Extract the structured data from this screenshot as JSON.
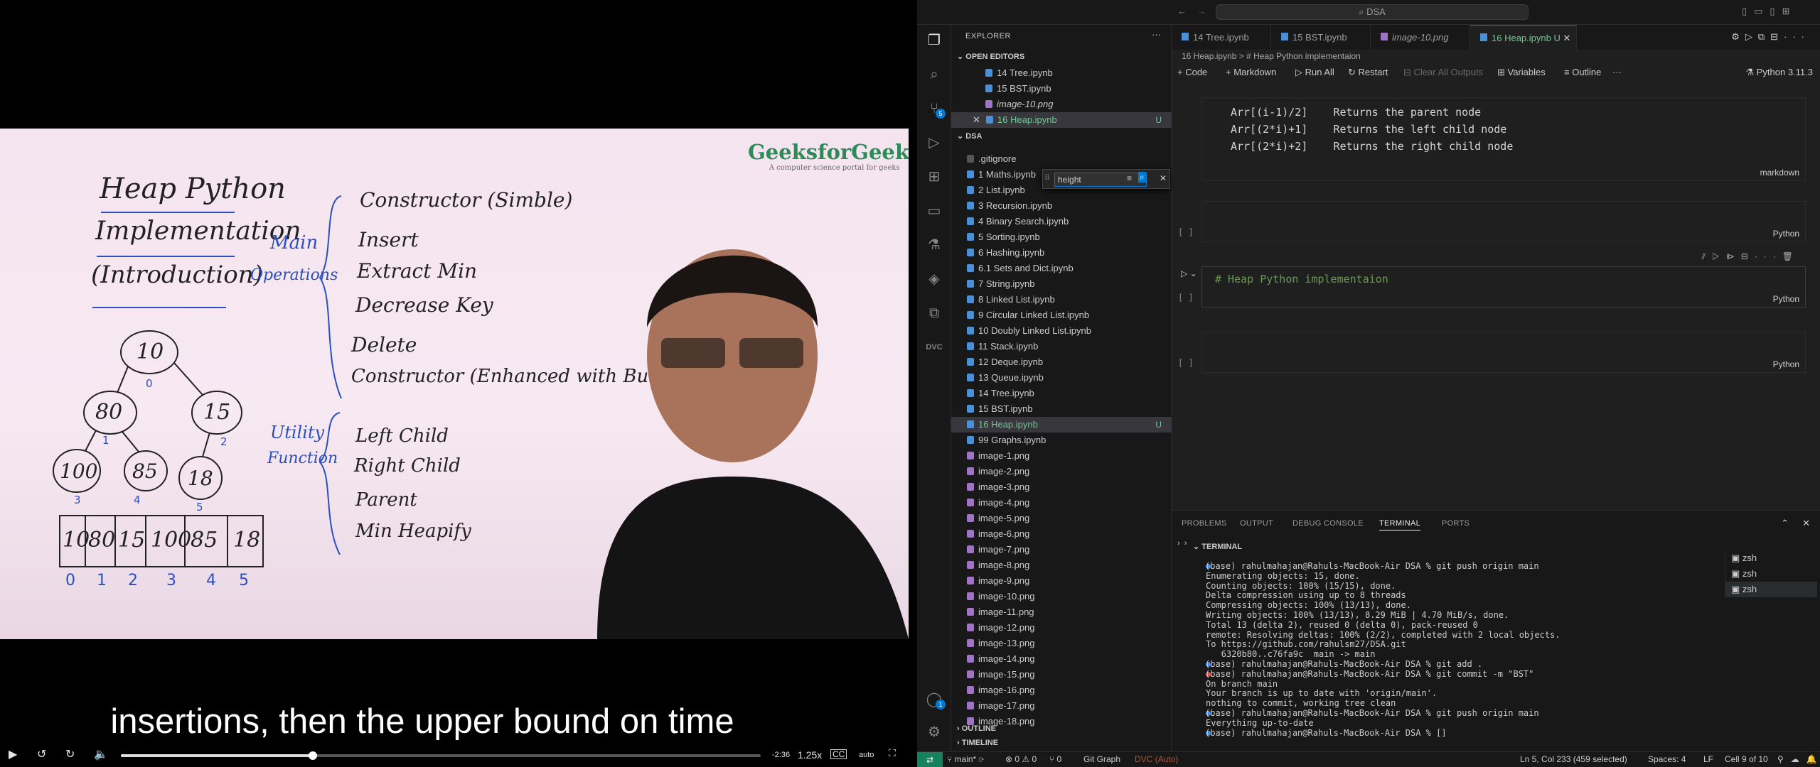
{
  "video": {
    "logo_brand": "GeeksforGeeks",
    "logo_tagline": "A computer science portal for geeks",
    "board_title_1": "Heap Python",
    "board_title_2": "Implementation",
    "board_title_3": "(Introduction)",
    "main_label": "Main",
    "operations_label": "Operations",
    "operations": [
      "Constructor (Simble)",
      "Insert",
      "Extract Min",
      "Decrease Key",
      "Delete",
      "Constructor (Enhanced with BuildHeap)"
    ],
    "utility_label": "Utility",
    "function_label": "Function",
    "utility_items": [
      "Left Child",
      "Right Child",
      "Parent",
      "Min Heapify"
    ],
    "tree_nodes": [
      "10",
      "80",
      "15",
      "100",
      "85",
      "18"
    ],
    "tree_indices": [
      "0",
      "1",
      "2",
      "3",
      "4",
      "5"
    ],
    "array_cells": [
      "10",
      "80",
      "15",
      "100",
      "85",
      "18"
    ],
    "array_indices": [
      "0",
      "1",
      "2",
      "3",
      "4",
      "5"
    ],
    "caption": "insertions, then the upper bound on time",
    "time_remaining": "-2:36",
    "speed": "1.25x",
    "quality": "auto",
    "progress": 0.3
  },
  "vscode": {
    "search": "DSA",
    "explorer_title": "EXPLORER",
    "open_editors_label": "OPEN EDITORS",
    "open_editors": [
      "14 Tree.ipynb",
      "15 BST.ipynb",
      "image-10.png",
      "16 Heap.ipynb"
    ],
    "folder_label": "DSA",
    "files": [
      ".gitignore",
      "1 Maths.ipynb",
      "2 List.ipynb",
      "3 Recursion.ipynb",
      "4 Binary Search.ipynb",
      "5 Sorting.ipynb",
      "6 Hashing.ipynb",
      "6.1 Sets and Dict.ipynb",
      "7 String.ipynb",
      "8 Linked List.ipynb",
      "9 Circular Linked List.ipynb",
      "10 Doubly Linked List.ipynb",
      "11 Stack.ipynb",
      "12 Deque.ipynb",
      "13 Queue.ipynb",
      "14 Tree.ipynb",
      "15 BST.ipynb",
      "16 Heap.ipynb",
      "99 Graphs.ipynb",
      "image-1.png",
      "image-2.png",
      "image-3.png",
      "image-4.png",
      "image-5.png",
      "image-6.png",
      "image-7.png",
      "image-8.png",
      "image-9.png",
      "image-10.png",
      "image-11.png",
      "image-12.png",
      "image-13.png",
      "image-14.png",
      "image-15.png",
      "image-16.png",
      "image-17.png",
      "image-18.png"
    ],
    "u_marker": "U",
    "find_value": "height",
    "outline_label": "OUTLINE",
    "timeline_label": "TIMELINE",
    "tabs": [
      "14 Tree.ipynb",
      "15 BST.ipynb",
      "image-10.png",
      "16 Heap.ipynb U"
    ],
    "breadcrumb": "16 Heap.ipynb > # Heap Python implementaion",
    "toolbar": {
      "code": "+ Code",
      "markdown": "+ Markdown",
      "run_all": "Run All",
      "restart": "Restart",
      "clear": "Clear All Outputs",
      "variables": "Variables",
      "outline": "Outline",
      "more": "···",
      "kernel": "Python 3.11.3"
    },
    "markdown_lines": [
      "Arr[(i-1)/2]    Returns the parent node",
      "Arr[(2*i)+1]    Returns the left child node",
      "Arr[(2*i)+2]    Returns the right child node"
    ],
    "markdown_lang": "markdown",
    "empty_bracket": "[ ]",
    "cell_lang": "Python",
    "heap_cell_code": "# Heap Python implementaion",
    "panel_tabs": [
      "PROBLEMS",
      "OUTPUT",
      "DEBUG CONSOLE",
      "TERMINAL",
      "PORTS"
    ],
    "terminal_label": "TERMINAL",
    "terminal_lines": [
      "(base) rahulmahajan@Rahuls-MacBook-Air DSA % git push origin main",
      "Enumerating objects: 15, done.",
      "Counting objects: 100% (15/15), done.",
      "Delta compression using up to 8 threads",
      "Compressing objects: 100% (13/13), done.",
      "Writing objects: 100% (13/13), 8.29 MiB | 4.70 MiB/s, done.",
      "Total 13 (delta 2), reused 0 (delta 0), pack-reused 0",
      "remote: Resolving deltas: 100% (2/2), completed with 2 local objects.",
      "To https://github.com/rahulsm27/DSA.git",
      "   6320b80..c76fa9c  main -> main",
      "(base) rahulmahajan@Rahuls-MacBook-Air DSA % git add .",
      "(base) rahulmahajan@Rahuls-MacBook-Air DSA % git commit -m \"BST\"",
      "On branch main",
      "Your branch is up to date with 'origin/main'.",
      "",
      "nothing to commit, working tree clean",
      "(base) rahulmahajan@Rahuls-MacBook-Air DSA % git push origin main",
      "Everything up-to-date",
      "(base) rahulmahajan@Rahuls-MacBook-Air DSA % []"
    ],
    "terminal_list": [
      "zsh",
      "zsh",
      "zsh"
    ],
    "status": {
      "branch": "main*",
      "errors": "⊗ 0",
      "warnings": "⚠ 0",
      "ports": "⑂ 0",
      "gitgraph": "Git Graph",
      "dvc": "DVC (Auto)",
      "position": "Ln 5, Col 233 (459 selected)",
      "spaces": "Spaces: 4",
      "eol": "LF",
      "cell": "Cell 9 of 10"
    },
    "badges": {
      "scm": "5",
      "accounts": "1"
    }
  }
}
